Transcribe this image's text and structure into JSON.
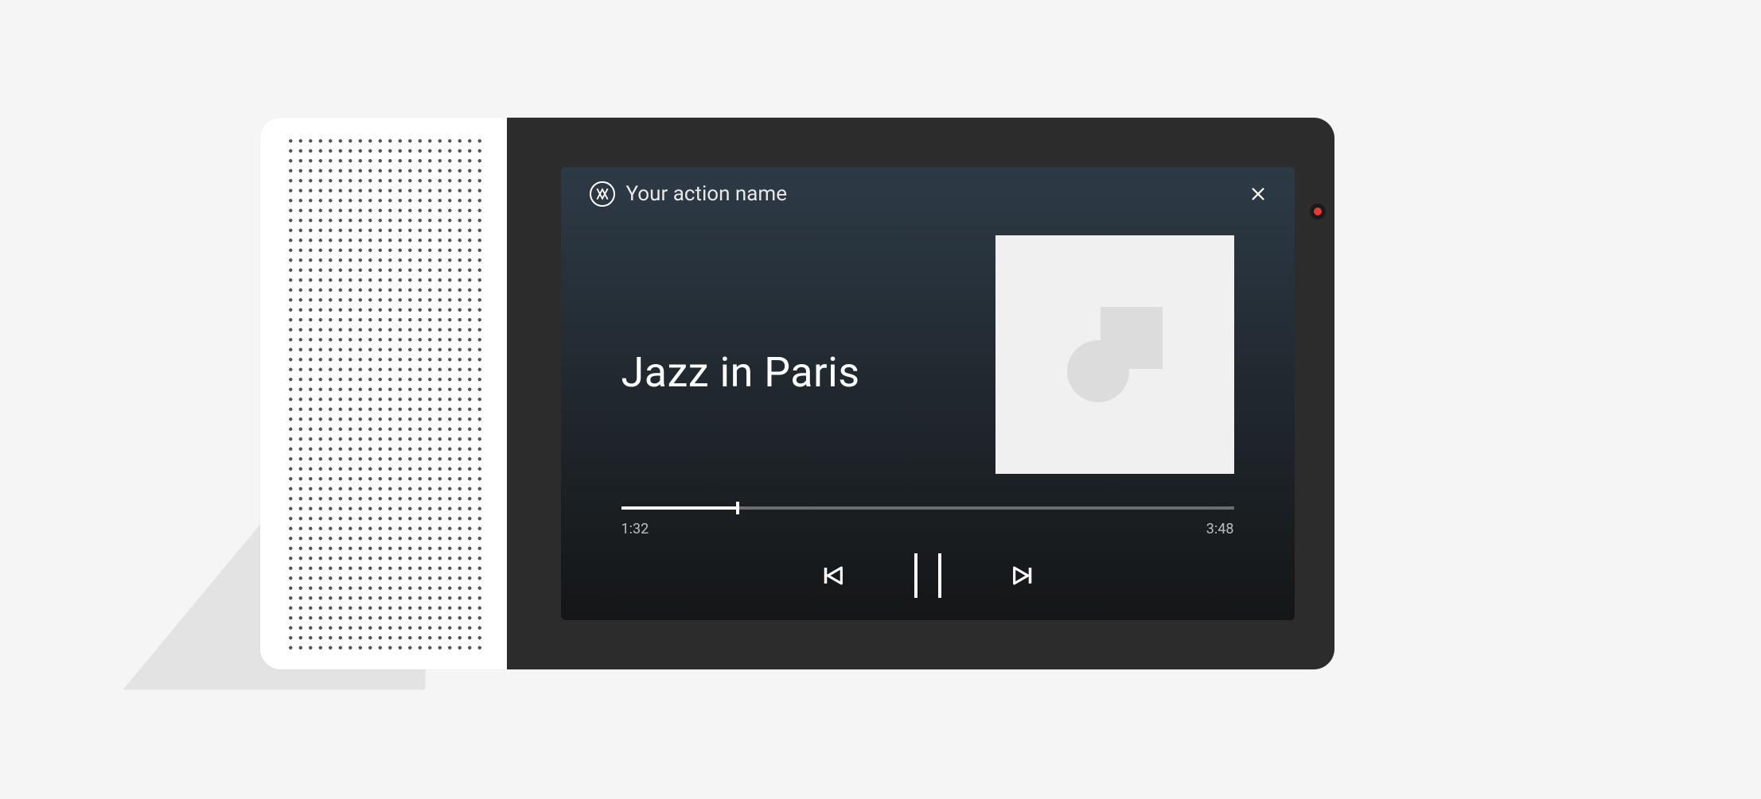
{
  "header": {
    "action_name": "Your action name"
  },
  "track": {
    "title": "Jazz in Paris"
  },
  "progress": {
    "elapsed": "1:32",
    "total": "3:48",
    "percent": 19
  },
  "icons": {
    "close": "close-icon",
    "prev": "skip-previous-icon",
    "pause": "pause-icon",
    "next": "skip-next-icon",
    "action": "action-logo-icon",
    "rec": "record-indicator"
  },
  "colors": {
    "screen_bg": "#2c2c2c",
    "card_gradient_top": "#2d3a46",
    "card_gradient_bottom": "#141617",
    "accent_red": "#e53935"
  }
}
